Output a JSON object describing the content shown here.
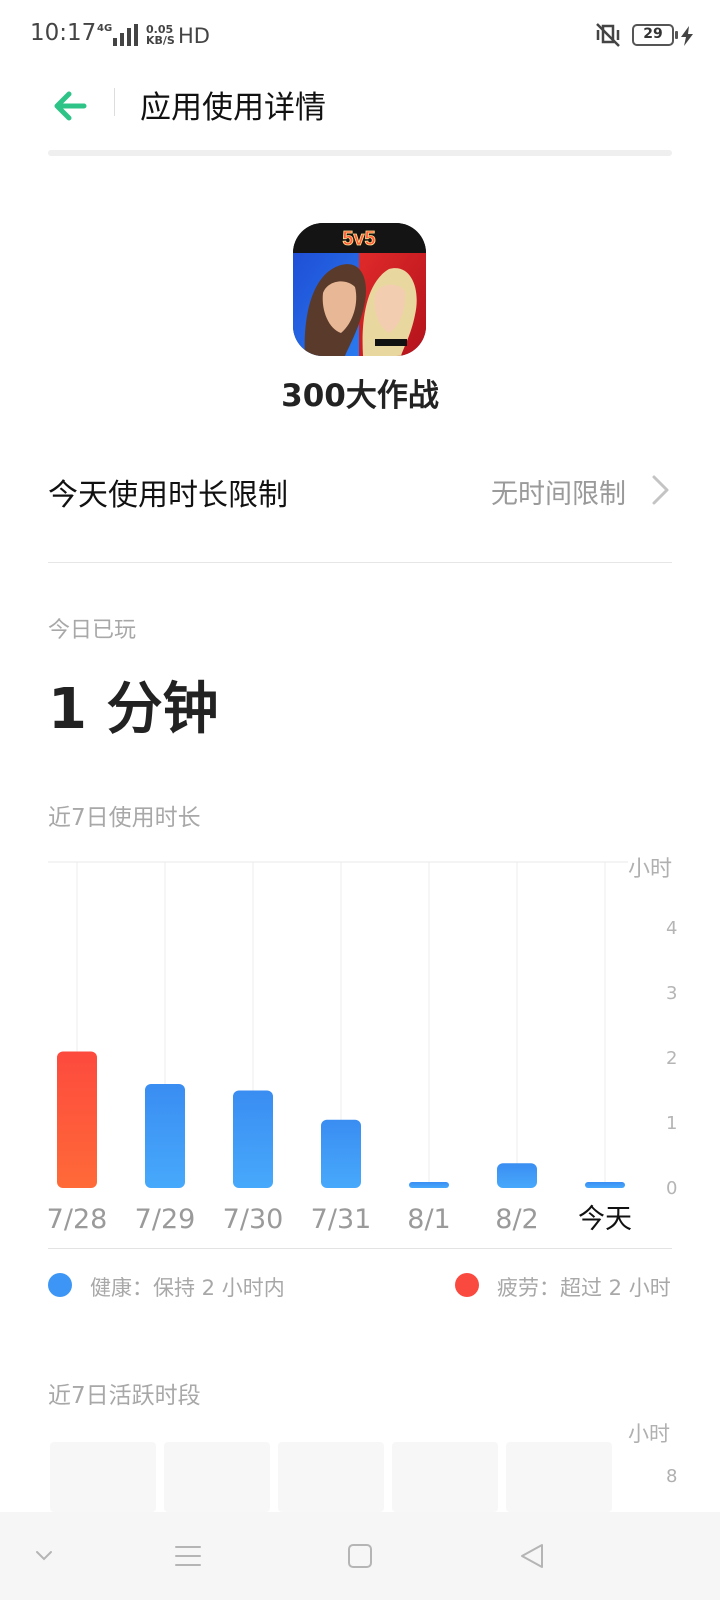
{
  "status_bar": {
    "time": "10:17",
    "network": "4G",
    "speed_top": "0.05",
    "speed_bottom": "KB/S",
    "hd": "HD",
    "battery": "29"
  },
  "header": {
    "title": "应用使用详情"
  },
  "app": {
    "name": "300大作战",
    "icon_badge": "5v5"
  },
  "limit": {
    "label": "今天使用时长限制",
    "value": "无时间限制"
  },
  "today": {
    "label": "今日已玩",
    "value": "1 分钟"
  },
  "chart_data": {
    "type": "bar",
    "title": "近7日使用时长",
    "unit_label": "小时",
    "categories": [
      "7/28",
      "7/29",
      "7/30",
      "7/31",
      "8/1",
      "8/2",
      "今天"
    ],
    "values": [
      2.1,
      1.6,
      1.5,
      1.05,
      0.05,
      0.38,
      0.05
    ],
    "status": [
      "tired",
      "healthy",
      "healthy",
      "healthy",
      "healthy",
      "healthy",
      "healthy"
    ],
    "y_ticks": [
      "4",
      "3",
      "2",
      "1",
      "0"
    ],
    "ylim": [
      0,
      4.8
    ],
    "highlight_category": "今天",
    "colors": {
      "healthy": "#3d96f5",
      "tired": "#fa5038"
    },
    "grid": true
  },
  "legend": {
    "healthy": "健康：保持 2 小时内",
    "tired": "疲劳：超过 2 小时"
  },
  "active": {
    "title": "近7日活跃时段",
    "unit_label": "小时",
    "tick": "8",
    "cells": 5
  },
  "colors": {
    "accent": "#2fc487",
    "healthy": "#3d96f5",
    "tired": "#fa4a40"
  }
}
